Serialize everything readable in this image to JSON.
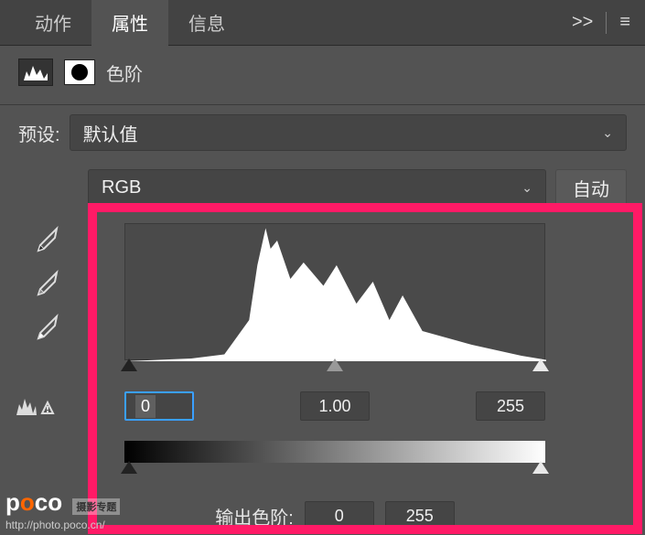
{
  "tabs": {
    "actions": "动作",
    "properties": "属性",
    "info": "信息",
    "more": ">>",
    "menu": "≡"
  },
  "header": {
    "title": "色阶"
  },
  "preset": {
    "label": "预设:",
    "value": "默认值"
  },
  "channel": {
    "value": "RGB",
    "auto": "自动"
  },
  "input_levels": {
    "black": "0",
    "mid": "1.00",
    "white": "255"
  },
  "output_levels": {
    "label": "输出色阶:",
    "black": "0",
    "white": "255"
  },
  "watermark": {
    "brand_p": "p",
    "brand_rest": "co",
    "brand_o": "o",
    "tag": "摄影专题",
    "url": "http://photo.poco.cn/"
  },
  "chart_data": {
    "type": "area",
    "title": "",
    "xlabel": "",
    "ylabel": "",
    "x_range": [
      0,
      255
    ],
    "y_norm_range": [
      0,
      1
    ],
    "series": [
      {
        "name": "luminance-histogram",
        "x": [
          0,
          20,
          40,
          60,
          75,
          80,
          85,
          88,
          92,
          100,
          108,
          120,
          128,
          140,
          150,
          160,
          168,
          180,
          195,
          210,
          225,
          240,
          255
        ],
        "values": [
          0.0,
          0.01,
          0.02,
          0.05,
          0.3,
          0.7,
          0.97,
          0.82,
          0.88,
          0.6,
          0.72,
          0.55,
          0.7,
          0.42,
          0.58,
          0.3,
          0.48,
          0.22,
          0.17,
          0.12,
          0.08,
          0.04,
          0.01
        ]
      }
    ],
    "markers": {
      "input_black": 0,
      "input_mid": 1.0,
      "input_white": 255,
      "output_black": 0,
      "output_white": 255
    }
  }
}
